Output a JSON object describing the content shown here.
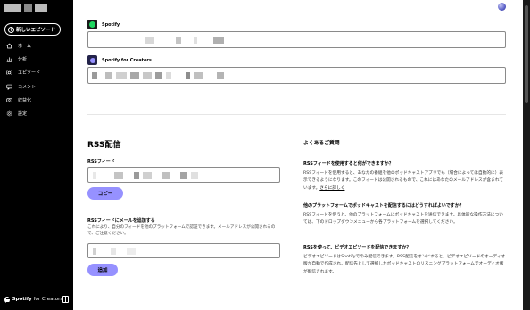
{
  "sidebar": {
    "new_episode_label": "新しいエピソード",
    "items": [
      {
        "label": "ホーム",
        "icon": "home-icon"
      },
      {
        "label": "分析",
        "icon": "analytics-icon"
      },
      {
        "label": "エピソード",
        "icon": "episodes-icon"
      },
      {
        "label": "コメント",
        "icon": "comments-icon"
      },
      {
        "label": "収益化",
        "icon": "monetization-icon"
      },
      {
        "label": "設定",
        "icon": "settings-icon"
      }
    ],
    "footer": {
      "brand": "Spotify",
      "suffix": " for Creators"
    }
  },
  "distribution": {
    "spotify_label": "Spotify",
    "creators_label": "Spotify for Creators"
  },
  "rss": {
    "title": "RSS配信",
    "feed_label": "RSSフィード",
    "copy_button": "コピー",
    "email_label": "RSSフィードにメールを追加する",
    "email_desc": "これにより、自分のフィードを他のプラットフォームで認証できます。メールアドレスが公開されるので、ご注意ください。",
    "add_button": "追加"
  },
  "faq": {
    "title": "よくあるご質問",
    "items": [
      {
        "question": "RSSフィードを使用すると何ができますか？",
        "answer": "RSSフィードを使用すると、あなたの番組を他のポッドキャストアプリでも（場合によっては自動的に）表示できるようになります。このフィードは公開されるもので、これにはあなたのメールアドレスが含まれています。",
        "link": "さらに詳しく"
      },
      {
        "question": "他のプラットフォームでポッドキャストを配信するにはどうすればよいですか？",
        "answer": "RSSフィードを使うと、他のプラットフォームにポッドキャストを送信できます。具体的な操作方法については、下のドロップダウンメニューから各プラットフォームを選択してください。"
      },
      {
        "question": "RSSを使って、ビデオエピソードを配信できますか？",
        "answer": "ビデオエピソードはSpotifyでのみ配信できます。RSS配信をオンにすると、ビデオエピソードのオーディオ版が自動で作成され、配信先として選択したポッドキャストのリスニングプラットフォームでオーディオ版が配信されます。"
      }
    ]
  },
  "colors": {
    "accent": "#9691ff",
    "spotify_green": "#1ed760",
    "sidebar_bg": "#000000"
  }
}
